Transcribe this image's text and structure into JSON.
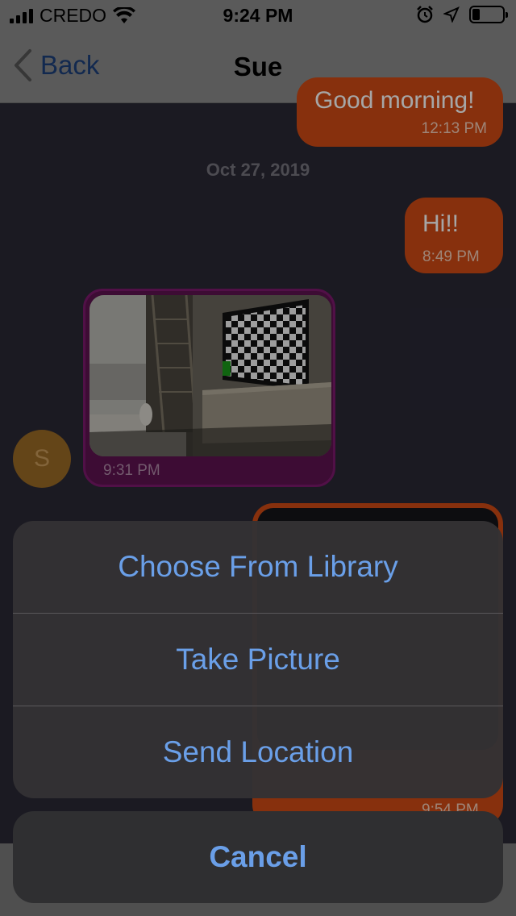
{
  "status_bar": {
    "carrier": "CREDO",
    "time": "9:24 PM",
    "battery_level": 0.25
  },
  "nav": {
    "back_label": "Back",
    "title": "Sue"
  },
  "messages": {
    "partial_out": {
      "text": "Good morning!",
      "time": "12:13 PM"
    },
    "date_separator": "Oct 27, 2019",
    "hi": {
      "text": "Hi!!",
      "time": "8:49 PM"
    },
    "image_msg": {
      "time": "9:31 PM"
    },
    "avatar_initial": "S",
    "partial_out_bottom": {
      "time": "9:54 PM"
    }
  },
  "action_sheet": {
    "items": [
      "Choose From Library",
      "Take Picture",
      "Send Location"
    ],
    "cancel_label": "Cancel"
  },
  "colors": {
    "outgoing_bubble": "#cf4b14",
    "image_bubble": "#5e1351",
    "action_text": "#6a9fe8"
  }
}
